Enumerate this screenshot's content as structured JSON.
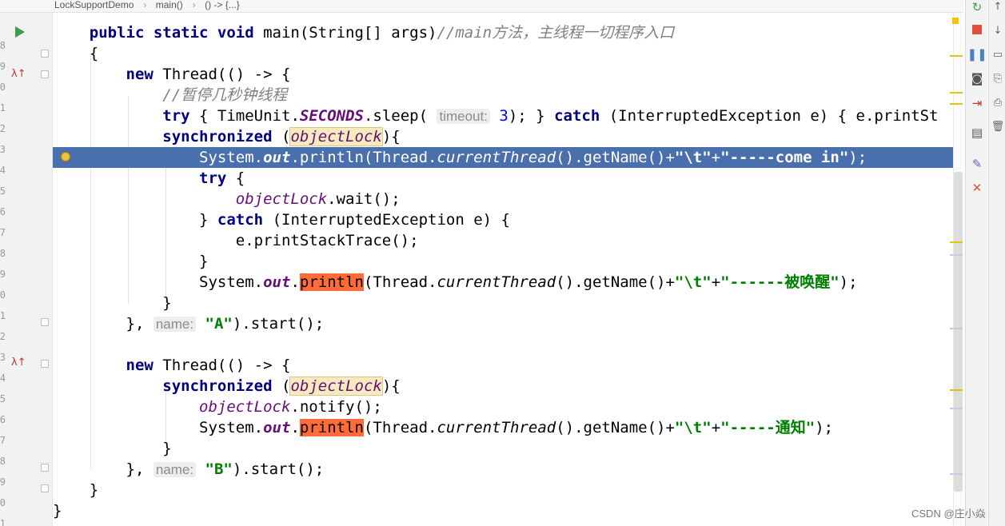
{
  "breadcrumb": {
    "items": [
      "LockSupportDemo",
      "main()",
      "() -> {...}"
    ]
  },
  "gutter": {
    "line_numbers": [
      "8",
      "9",
      "0",
      "1",
      "2",
      "3",
      "4",
      "5",
      "6",
      "7",
      "8",
      "9",
      "0",
      "1",
      "2",
      "3",
      "4",
      "5",
      "6",
      "7",
      "8",
      "9",
      "0",
      "1"
    ]
  },
  "code": {
    "main_sig": {
      "kw": "public static void",
      "rest": " main(String[] args)",
      "comment": "//main方法，主线程一切程序入口"
    },
    "open1": "{",
    "l_new1": {
      "kw": "new",
      "rest": " Thread(() -> {"
    },
    "comment2": "//暂停几秒钟线程",
    "try_line": {
      "kw_try": "try",
      "a": " { TimeUnit.",
      "seconds": "SECONDS",
      "b": ".sleep( ",
      "hint": "timeout:",
      "num": " 3",
      "c": "); } ",
      "kw_catch": "catch",
      "d": " (InterruptedException e) { e.printSt"
    },
    "sync1": {
      "kw": "synchronized",
      "a": " (",
      "var": "objectLock",
      "b": "){"
    },
    "print1": {
      "a": "System.",
      "out": "out",
      "b": ".println(Thread.",
      "ct": "currentThread",
      "c": "().getName()+",
      "s1": "\"\\t\"",
      "plus": "+",
      "s2": "\"-----come in\"",
      "d": ");"
    },
    "try2": {
      "kw": "try",
      "rest": " {"
    },
    "wait": {
      "var": "objectLock",
      "rest": ".wait();"
    },
    "catch2": {
      "a": "} ",
      "kw": "catch",
      "rest": " (InterruptedException e) {"
    },
    "pst": "e.printStackTrace();",
    "close_brace": "}",
    "print2": {
      "a": "System.",
      "out": "out",
      "dot": ".",
      "println": "println",
      "b": "(Thread.",
      "ct": "currentThread",
      "c": "().getName()+",
      "s1": "\"\\t\"",
      "plus": "+",
      "s2": "\"------被唤醒\"",
      "d": ");"
    },
    "close_a": {
      "a": "}, ",
      "hint": "name:",
      "s": " \"A\"",
      "b": ").start();"
    },
    "l_new2": {
      "kw": "new",
      "rest": " Thread(() -> {"
    },
    "sync2": {
      "kw": "synchronized",
      "a": " (",
      "var": "objectLock",
      "b": "){"
    },
    "notify": {
      "var": "objectLock",
      "rest": ".notify();"
    },
    "print3": {
      "a": "System.",
      "out": "out",
      "dot": ".",
      "println": "println",
      "b": "(Thread.",
      "ct": "currentThread",
      "c": "().getName()+",
      "s1": "\"\\t\"",
      "plus": "+",
      "s2": "\"-----通知\"",
      "d": ");"
    },
    "close_b": {
      "a": "}, ",
      "hint": "name:",
      "s": " \"B\"",
      "b": ").start();"
    }
  },
  "toolbar": {
    "icons": [
      "rerun-icon",
      "stop-icon",
      "pause-icon",
      "camera-icon",
      "exit-icon",
      "layout-icon",
      "pin-icon",
      "close-icon"
    ]
  },
  "watermark": "CSDN @庄小焱",
  "colors": {
    "highlight_line": "#4a6fad",
    "keyword": "#000080",
    "string": "#008000",
    "field": "#660e7a",
    "search_match": "#ff6c37"
  }
}
